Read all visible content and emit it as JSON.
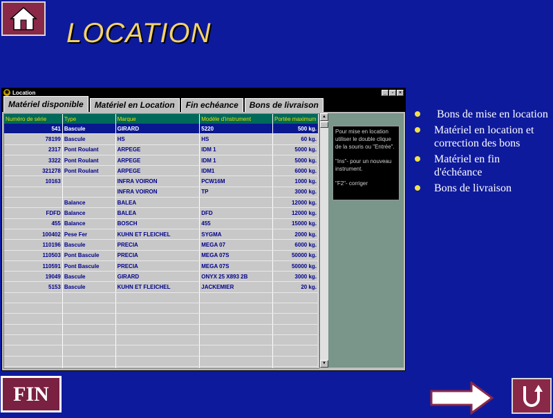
{
  "page": {
    "title": "LOCATION",
    "colors": {
      "background": "#0e1a9c",
      "accent": "#8a2848",
      "title": "#f2d26a"
    }
  },
  "window": {
    "title": "Location",
    "tabs": [
      {
        "label": "Matériel disponible",
        "active": true
      },
      {
        "label": "Matériel en Location",
        "active": false
      },
      {
        "label": "Fin echéance",
        "active": false
      },
      {
        "label": "Bons de livraison",
        "active": false
      }
    ],
    "columns": [
      "Numéro de série",
      "Type",
      "Marque",
      "Modèle d'instrument",
      "Portée maximum"
    ],
    "rows": [
      [
        "541",
        "Bascule",
        "GIRARD",
        "5220",
        "500 kg."
      ],
      [
        "78199",
        "Bascule",
        "HS",
        "HS",
        "60 kg."
      ],
      [
        "2317",
        "Pont Roulant",
        "ARPEGE",
        "IDM 1",
        "5000 kg."
      ],
      [
        "3322",
        "Pont Roulant",
        "ARPEGE",
        "IDM 1",
        "5000 kg."
      ],
      [
        "321278",
        "Pont Roulant",
        "ARPEGE",
        "IDM1",
        "6000 kg."
      ],
      [
        "10163",
        "",
        "INFRA VOIRON",
        "PCW16M",
        "1000 kg."
      ],
      [
        "",
        "",
        "INFRA VOIRON",
        "TP",
        "3000 kg."
      ],
      [
        "",
        "Balance",
        "BALEA",
        "",
        "12000 kg."
      ],
      [
        "FDFD",
        "Balance",
        "BALEA",
        "DFD",
        "12000 kg."
      ],
      [
        "455",
        "Balance",
        "BOSCH",
        "455",
        "15000 kg."
      ],
      [
        "100402",
        "Pese Fer",
        "KUHN ET FLEICHEL",
        "SYGMA",
        "2000 kg."
      ],
      [
        "110196",
        "Bascule",
        "PRECIA",
        "MEGA 07",
        "6000 kg."
      ],
      [
        "110503",
        "Pont Bascule",
        "PRECIA",
        "MEGA 07S",
        "50000 kg."
      ],
      [
        "110591",
        "Pont Bascule",
        "PRECIA",
        "MEGA 07S",
        "50000 kg."
      ],
      [
        "19049",
        "Bascule",
        "GIRARD",
        "ONYX 25 X893 2B",
        "3000 kg."
      ],
      [
        "5153",
        "Bascule",
        "KUHN ET FLEICHEL",
        "JACKEMIER",
        "20 kg."
      ]
    ],
    "help": {
      "line1": "Pour mise en location utiliser le double clique de la souris ou \"Entrée\".",
      "line2": "\"Ins\"- pour un nouveau instrument.",
      "line3": "\"F2\"- corriger"
    }
  },
  "menu": [
    "Bons de mise en location",
    "Matériel en location et correction des bons",
    "Matériel en fin d'échéance",
    "Bons de livraison"
  ],
  "footer": {
    "fin_label": "FIN"
  },
  "icons": {
    "home": "home-icon",
    "next": "arrow-right-icon",
    "back": "u-turn-icon"
  }
}
